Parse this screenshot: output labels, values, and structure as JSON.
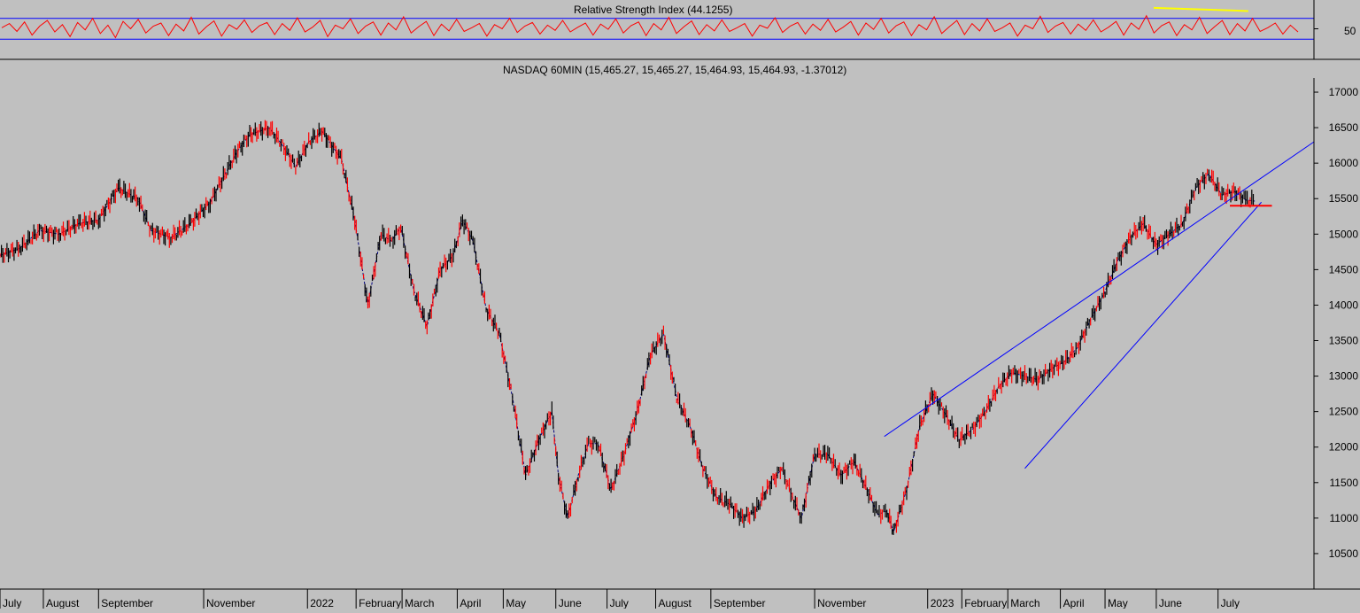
{
  "rsi_panel": {
    "title": "Relative Strength Index (44.1255)",
    "value": 44.1255,
    "upper_band": 70,
    "lower_band": 30,
    "tick_label": "50",
    "line_color": "#ff0000",
    "band_color": "#0000ff",
    "annotation_color": "#ffff00"
  },
  "price_panel": {
    "title": "NASDAQ 60MIN (15,465.27, 15,465.27, 15,464.93, 15,464.93, -1.37012)"
  },
  "chart_data": [
    {
      "type": "line",
      "title": "Relative Strength Index (44.1255)",
      "ylim": [
        0,
        100
      ],
      "yticks": [
        50
      ],
      "bands": [
        70,
        30
      ],
      "series": [
        {
          "values": [
            52,
            60,
            45,
            63,
            38,
            55,
            66,
            44,
            58,
            35,
            62,
            48,
            70,
            41,
            57,
            33,
            64,
            50,
            68,
            42,
            55,
            61,
            37,
            59,
            46,
            72,
            40,
            54,
            65,
            36,
            58,
            49,
            67,
            43,
            56,
            62,
            39,
            60,
            47,
            71,
            44,
            53,
            66,
            35,
            57,
            50,
            69,
            41,
            55,
            63,
            38,
            61,
            48,
            73,
            42,
            54,
            64,
            37,
            59,
            46,
            68,
            45,
            52,
            60,
            36,
            58,
            50,
            70,
            43,
            55,
            62,
            40,
            57,
            47,
            66,
            44,
            53,
            61,
            38,
            59,
            49,
            69,
            42,
            56,
            63,
            37,
            60,
            48,
            72,
            41,
            54,
            65,
            39,
            58,
            46,
            67,
            45,
            52,
            60,
            36,
            57,
            51,
            71,
            43,
            55,
            62,
            40,
            59,
            47,
            68,
            44,
            53,
            64,
            38,
            61,
            49,
            70,
            42,
            56,
            63,
            37,
            58,
            48,
            73,
            41,
            54,
            66,
            39,
            60,
            46,
            69,
            45,
            52,
            61,
            36,
            57,
            50,
            74,
            43,
            55,
            62,
            40,
            59,
            47,
            67,
            44,
            53,
            64,
            38,
            61,
            49,
            75,
            42,
            56,
            63,
            37,
            58,
            48,
            72,
            41,
            54,
            66,
            39,
            60,
            46,
            70,
            45,
            52,
            61,
            40,
            57,
            44
          ]
        }
      ],
      "annotation": {
        "type": "trendline",
        "color": "#ffff00",
        "from": [
          0.878,
          90
        ],
        "to": [
          0.95,
          84
        ]
      }
    },
    {
      "type": "line",
      "title": "NASDAQ 60MIN (15,465.27, 15,465.27, 15,464.93, 15,464.93, -1.37012)",
      "ylim": [
        10000,
        17200
      ],
      "yticks": [
        10500,
        11000,
        11500,
        12000,
        12500,
        13000,
        13500,
        14000,
        14500,
        15000,
        15500,
        16000,
        16500,
        17000
      ],
      "month_labels": [
        "July",
        "August",
        "September",
        "November",
        "2022",
        "February",
        "March",
        "April",
        "May",
        "June",
        "July",
        "August",
        "September",
        "November",
        "2023",
        "February",
        "March",
        "April",
        "May",
        "June",
        "July"
      ],
      "month_positions": [
        0.0,
        0.033,
        0.075,
        0.155,
        0.234,
        0.271,
        0.306,
        0.348,
        0.383,
        0.423,
        0.462,
        0.499,
        0.541,
        0.62,
        0.706,
        0.732,
        0.767,
        0.807,
        0.841,
        0.88,
        0.927
      ],
      "series": [
        {
          "name": "price",
          "x": [
            0.0,
            0.015,
            0.03,
            0.045,
            0.06,
            0.075,
            0.09,
            0.105,
            0.115,
            0.13,
            0.145,
            0.16,
            0.17,
            0.18,
            0.19,
            0.205,
            0.215,
            0.225,
            0.235,
            0.245,
            0.26,
            0.27,
            0.28,
            0.29,
            0.298,
            0.305,
            0.315,
            0.325,
            0.335,
            0.345,
            0.352,
            0.36,
            0.37,
            0.38,
            0.39,
            0.4,
            0.41,
            0.42,
            0.425,
            0.432,
            0.44,
            0.448,
            0.455,
            0.465,
            0.475,
            0.485,
            0.495,
            0.505,
            0.515,
            0.525,
            0.535,
            0.545,
            0.555,
            0.565,
            0.575,
            0.585,
            0.595,
            0.603,
            0.61,
            0.62,
            0.63,
            0.64,
            0.65,
            0.66,
            0.668,
            0.675,
            0.68,
            0.69,
            0.7,
            0.71,
            0.72,
            0.73,
            0.74,
            0.75,
            0.76,
            0.77,
            0.78,
            0.79,
            0.8,
            0.81,
            0.82,
            0.83,
            0.84,
            0.85,
            0.86,
            0.87,
            0.88,
            0.89,
            0.9,
            0.91,
            0.92,
            0.93,
            0.94,
            0.948,
            0.955
          ],
          "values": [
            14700,
            14800,
            15050,
            15000,
            15150,
            15200,
            15650,
            15500,
            15050,
            14950,
            15150,
            15450,
            15800,
            16150,
            16400,
            16500,
            16250,
            15950,
            16300,
            16450,
            16050,
            15200,
            14000,
            15000,
            14900,
            15100,
            14200,
            13700,
            14500,
            14700,
            15200,
            14900,
            13950,
            13600,
            12700,
            11600,
            12100,
            12500,
            11600,
            11000,
            11600,
            12050,
            12050,
            11400,
            11900,
            12500,
            13300,
            13600,
            12700,
            12300,
            11700,
            11300,
            11200,
            11000,
            11100,
            11450,
            11700,
            11300,
            11000,
            11900,
            11900,
            11600,
            11800,
            11400,
            11050,
            11100,
            10800,
            11400,
            12300,
            12750,
            12450,
            12100,
            12250,
            12500,
            12850,
            13050,
            13000,
            12950,
            13100,
            13200,
            13400,
            13800,
            14150,
            14600,
            14950,
            15150,
            14850,
            15000,
            15150,
            15650,
            15850,
            15550,
            15600,
            15480,
            15465
          ]
        },
        {
          "name": "upper-channel",
          "x": [
            0.673,
            1.0
          ],
          "values": [
            12150,
            16300
          ]
        },
        {
          "name": "lower-channel",
          "x": [
            0.78,
            0.96
          ],
          "values": [
            11700,
            15450
          ]
        },
        {
          "name": "support",
          "x": [
            0.936,
            0.968
          ],
          "values": [
            15400,
            15400
          ]
        }
      ]
    }
  ]
}
